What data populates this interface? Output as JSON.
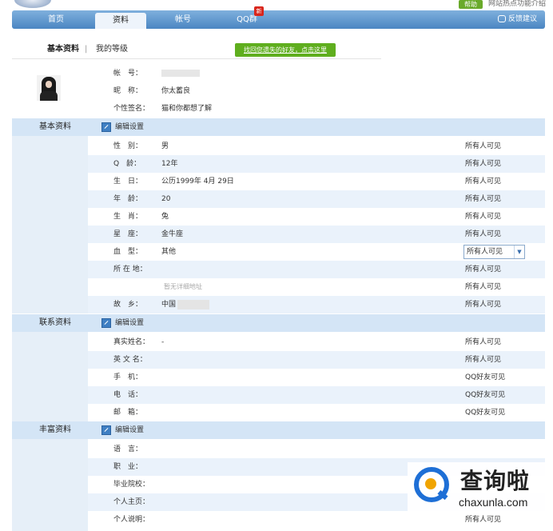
{
  "header": {
    "help_label": "帮助",
    "intro_link": "网站热点功能介绍"
  },
  "nav": {
    "tabs": [
      {
        "label": "首页",
        "active": false
      },
      {
        "label": "资料",
        "active": true
      },
      {
        "label": "帐号",
        "active": false
      },
      {
        "label": "QQ群",
        "active": false
      }
    ],
    "new_badge": "新",
    "feedback": "反馈建议"
  },
  "subtabs": {
    "basic": "基本资料",
    "separator": "|",
    "level": "我的等级"
  },
  "find_friends": "找回您遗失的好友，点击这里",
  "account": [
    {
      "label": "帐　号：",
      "value": ""
    },
    {
      "label": "昵　称：",
      "value": "你太蓄良"
    },
    {
      "label": "个性签名：",
      "value": "猫和你都想了解"
    }
  ],
  "sections": {
    "basic": {
      "title": "基本资料",
      "edit": "编辑设置",
      "rows": [
        {
          "label": "性　别：",
          "value": "男",
          "visibility": "所有人可见"
        },
        {
          "label": "Q　龄：",
          "value": "12年",
          "visibility": "所有人可见"
        },
        {
          "label": "生　日：",
          "value": "公历1999年 4月 29日",
          "visibility": "所有人可见"
        },
        {
          "label": "年　龄：",
          "value": "20",
          "visibility": "所有人可见"
        },
        {
          "label": "生　肖：",
          "value": "兔",
          "visibility": "所有人可见"
        },
        {
          "label": "星　座：",
          "value": "金牛座",
          "visibility": "所有人可见"
        },
        {
          "label": "血　型：",
          "value": "其他",
          "visibility": "所有人可见"
        },
        {
          "label": "所 在 地：",
          "value": "",
          "visibility": "所有人可见"
        },
        {
          "label": "",
          "value": "",
          "hint": "暂无详细地址",
          "visibility": "所有人可见"
        },
        {
          "label": "故　乡：",
          "value": "中国",
          "visibility": "所有人可见"
        }
      ]
    },
    "contact": {
      "title": "联系资料",
      "edit": "编辑设置",
      "rows": [
        {
          "label": "真实姓名：",
          "value": "-",
          "visibility": "所有人可见"
        },
        {
          "label": "英 文 名：",
          "value": "",
          "visibility": "所有人可见"
        },
        {
          "label": "手　机：",
          "value": "",
          "visibility": "QQ好友可见"
        },
        {
          "label": "电　话：",
          "value": "",
          "visibility": "QQ好友可见"
        },
        {
          "label": "邮　箱：",
          "value": "",
          "visibility": "QQ好友可见"
        }
      ]
    },
    "rich": {
      "title": "丰富资料",
      "edit": "编辑设置",
      "rows": [
        {
          "label": "语　言：",
          "value": "",
          "visibility": ""
        },
        {
          "label": "职　业：",
          "value": "",
          "visibility": ""
        },
        {
          "label": "毕业院校：",
          "value": "",
          "visibility": ""
        },
        {
          "label": "个人主页：",
          "value": "",
          "visibility": ""
        },
        {
          "label": "个人说明：",
          "value": "",
          "visibility": "所有人可见"
        }
      ]
    }
  },
  "dropdown_arrow": "▼",
  "watermark": {
    "title": "查询啦",
    "url": "chaxunla.com"
  }
}
